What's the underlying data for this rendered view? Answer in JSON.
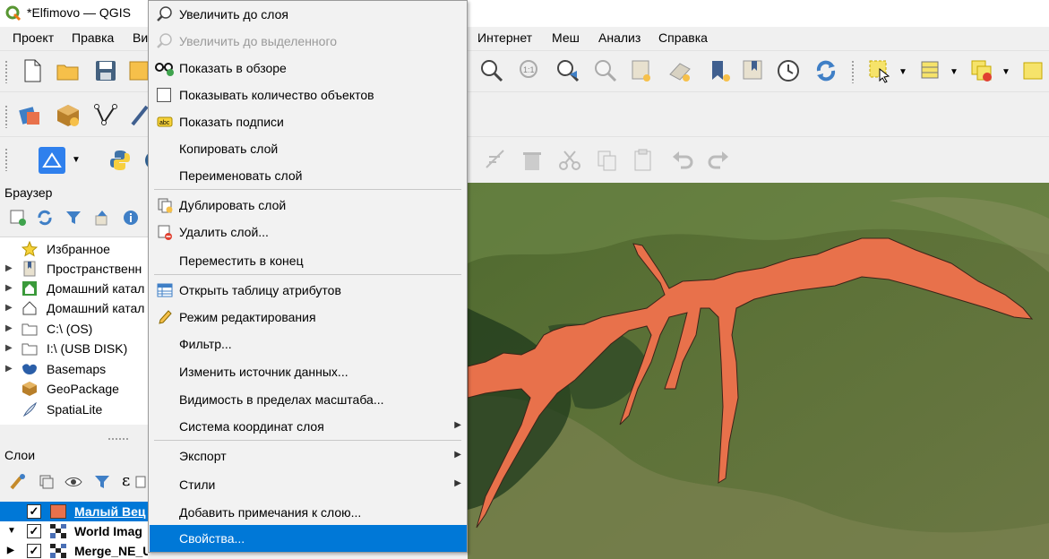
{
  "window": {
    "title": "*Elfimovo — QGIS",
    "app_icon": "qgis-logo"
  },
  "menubar": [
    {
      "label": "Проект"
    },
    {
      "label": "Правка"
    },
    {
      "label": "Ви"
    },
    {
      "label": "Интернет"
    },
    {
      "label": "Меш"
    },
    {
      "label": "Анализ"
    },
    {
      "label": "Справка"
    }
  ],
  "browser": {
    "title": "Браузер",
    "items": [
      {
        "label": "Избранное",
        "icon": "star-icon"
      },
      {
        "label": "Пространственн",
        "icon": "bookmark-icon"
      },
      {
        "label": "Домашний катал",
        "icon": "home-folder-icon"
      },
      {
        "label": "Домашний катал",
        "icon": "home-folder-icon"
      },
      {
        "label": "C:\\ (OS)",
        "icon": "folder-icon"
      },
      {
        "label": "I:\\ (USB DISK)",
        "icon": "folder-icon"
      },
      {
        "label": "Basemaps",
        "icon": "basemaps-icon"
      },
      {
        "label": "GeoPackage",
        "icon": "geopackage-icon"
      },
      {
        "label": "SpatiaLite",
        "icon": "spatialite-icon"
      }
    ]
  },
  "layers": {
    "title": "Слои",
    "items": [
      {
        "name": "Малый Вец",
        "swatch": "#e8714b",
        "checked": "✓"
      },
      {
        "name": "World Imag",
        "checked": "✓"
      },
      {
        "name": "Merge_NE_UTM",
        "checked": "✓"
      }
    ]
  },
  "context_menu": {
    "items": [
      {
        "label": "Увеличить до слоя",
        "icon": "zoom-to-layer-icon"
      },
      {
        "label": "Увеличить до выделенного",
        "icon": "zoom-to-selection-icon",
        "disabled": true
      },
      {
        "label": "Показать в обзоре",
        "icon": "overview-icon"
      },
      {
        "label": "Показывать количество объектов",
        "icon": "checkbox-icon"
      },
      {
        "label": "Показать подписи",
        "icon": "labels-icon"
      },
      {
        "label": "Копировать слой"
      },
      {
        "label": "Переименовать слой"
      },
      {
        "label": "Дублировать слой",
        "icon": "duplicate-layer-icon"
      },
      {
        "label": "Удалить слой...",
        "icon": "remove-layer-icon"
      },
      {
        "label": "Переместить в конец"
      },
      {
        "label": "Открыть таблицу атрибутов",
        "icon": "attribute-table-icon"
      },
      {
        "label": "Режим редактирования",
        "icon": "pencil-icon"
      },
      {
        "label": "Фильтр..."
      },
      {
        "label": "Изменить источник данных..."
      },
      {
        "label": "Видимость в пределах масштаба..."
      },
      {
        "label": "Система координат слоя",
        "submenu": true
      },
      {
        "label": "Экспорт",
        "submenu": true
      },
      {
        "label": "Стили",
        "submenu": true
      },
      {
        "label": "Добавить примечания к слою..."
      },
      {
        "label": "Свойства...",
        "selected": true
      }
    ]
  },
  "map": {
    "polygon_color": "#e8714b"
  }
}
